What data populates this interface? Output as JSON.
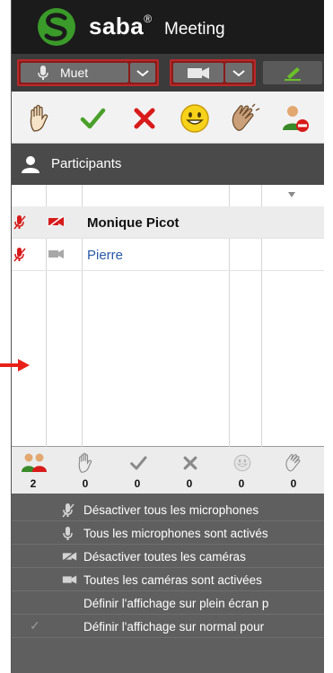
{
  "header": {
    "brand": "saba",
    "registered": "®",
    "product": "Meeting"
  },
  "mediabar": {
    "mic_label": "Muet"
  },
  "status_icons": [
    "raise-hand-icon",
    "agree-check-icon",
    "disagree-x-icon",
    "smile-icon",
    "applause-icon",
    "step-away-icon"
  ],
  "participants": {
    "title": "Participants",
    "rows": [
      {
        "name": "Monique Picot",
        "mic": "mic-muted-icon",
        "cam": "camera-off-icon",
        "selected": true
      },
      {
        "name": "Pierre",
        "mic": "mic-muted-icon",
        "cam": "camera-icon",
        "selected": false
      }
    ]
  },
  "counts": [
    {
      "icon": "attendees-icon",
      "value": "2"
    },
    {
      "icon": "raise-hand-icon",
      "value": "0"
    },
    {
      "icon": "agree-check-icon",
      "value": "0"
    },
    {
      "icon": "disagree-x-icon",
      "value": "0"
    },
    {
      "icon": "smile-icon",
      "value": "0"
    },
    {
      "icon": "applause-icon",
      "value": "0"
    }
  ],
  "menu": [
    {
      "label": "Désactiver tous les microphones",
      "icon": "mic-muted-icon"
    },
    {
      "label": "Tous les microphones sont activés",
      "icon": "mic-icon"
    },
    {
      "label": "Désactiver toutes les caméras",
      "icon": "camera-off-icon"
    },
    {
      "label": "Toutes les caméras sont activées",
      "icon": "camera-icon"
    },
    {
      "label": "Définir l'affichage sur plein écran p",
      "icon": ""
    },
    {
      "label": "Définir l'affichage sur normal pour",
      "icon": "",
      "checked": "✓"
    }
  ],
  "colors": {
    "header": "#1b1b1b",
    "accent_red": "#8b1a1a",
    "brand_green": "#3a9a2a",
    "link": "#2a5aa8"
  }
}
